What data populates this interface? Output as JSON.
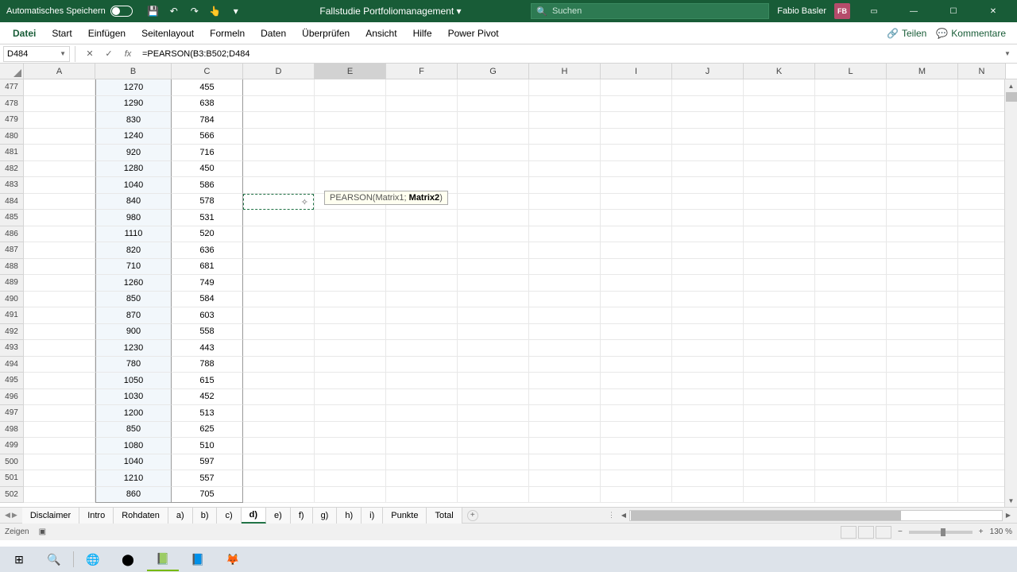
{
  "titlebar": {
    "autosave_label": "Automatisches Speichern",
    "doc_title": "Fallstudie Portfoliomanagement",
    "search_placeholder": "Suchen",
    "user_name": "Fabio Basler",
    "user_initials": "FB"
  },
  "ribbon": {
    "tabs": [
      "Datei",
      "Start",
      "Einfügen",
      "Seitenlayout",
      "Formeln",
      "Daten",
      "Überprüfen",
      "Ansicht",
      "Hilfe",
      "Power Pivot"
    ],
    "share": "Teilen",
    "comments": "Kommentare"
  },
  "formula_bar": {
    "name": "D484",
    "formula": "=PEARSON(B3:B502;D484"
  },
  "columns": [
    "A",
    "B",
    "C",
    "D",
    "E",
    "F",
    "G",
    "H",
    "I",
    "J",
    "K",
    "L",
    "M",
    "N"
  ],
  "selected_col": "E",
  "rows": [
    {
      "n": 477,
      "b": "1270",
      "c": "455"
    },
    {
      "n": 478,
      "b": "1290",
      "c": "638"
    },
    {
      "n": 479,
      "b": "830",
      "c": "784"
    },
    {
      "n": 480,
      "b": "1240",
      "c": "566"
    },
    {
      "n": 481,
      "b": "920",
      "c": "716"
    },
    {
      "n": 482,
      "b": "1280",
      "c": "450"
    },
    {
      "n": 483,
      "b": "1040",
      "c": "586"
    },
    {
      "n": 484,
      "b": "840",
      "c": "578"
    },
    {
      "n": 485,
      "b": "980",
      "c": "531"
    },
    {
      "n": 486,
      "b": "1110",
      "c": "520"
    },
    {
      "n": 487,
      "b": "820",
      "c": "636"
    },
    {
      "n": 488,
      "b": "710",
      "c": "681"
    },
    {
      "n": 489,
      "b": "1260",
      "c": "749"
    },
    {
      "n": 490,
      "b": "850",
      "c": "584"
    },
    {
      "n": 491,
      "b": "870",
      "c": "603"
    },
    {
      "n": 492,
      "b": "900",
      "c": "558"
    },
    {
      "n": 493,
      "b": "1230",
      "c": "443"
    },
    {
      "n": 494,
      "b": "780",
      "c": "788"
    },
    {
      "n": 495,
      "b": "1050",
      "c": "615"
    },
    {
      "n": 496,
      "b": "1030",
      "c": "452"
    },
    {
      "n": 497,
      "b": "1200",
      "c": "513"
    },
    {
      "n": 498,
      "b": "850",
      "c": "625"
    },
    {
      "n": 499,
      "b": "1080",
      "c": "510"
    },
    {
      "n": 500,
      "b": "1040",
      "c": "597"
    },
    {
      "n": 501,
      "b": "1210",
      "c": "557"
    },
    {
      "n": 502,
      "b": "860",
      "c": "705"
    }
  ],
  "tooltip": {
    "fn": "PEARSON(",
    "arg1": "Matrix1",
    "sep": "; ",
    "arg2": "Matrix2",
    "close": ")"
  },
  "sheet_tabs": [
    "Disclaimer",
    "Intro",
    "Rohdaten",
    "a)",
    "b)",
    "c)",
    "d)",
    "e)",
    "f)",
    "g)",
    "h)",
    "i)",
    "Punkte",
    "Total"
  ],
  "active_sheet": "d)",
  "statusbar": {
    "mode": "Zeigen",
    "zoom": "130 %"
  }
}
